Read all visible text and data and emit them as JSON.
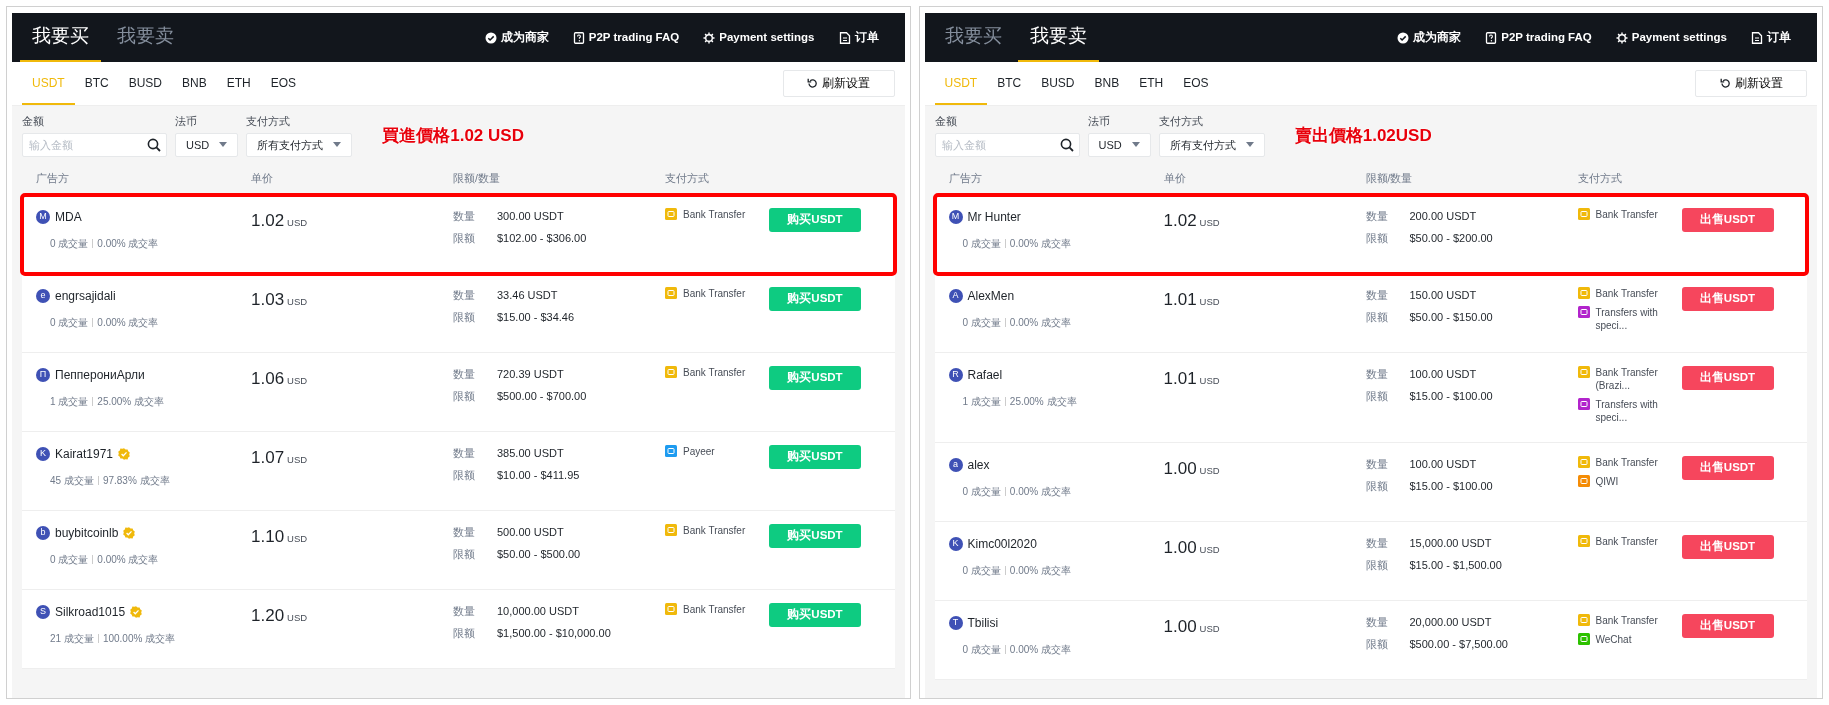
{
  "panels": [
    {
      "kind": "buy",
      "main_tabs": [
        {
          "label": "我要买",
          "selected": true
        },
        {
          "label": "我要卖",
          "selected": false
        }
      ],
      "header_links": [
        "成为商家",
        "P2P trading FAQ",
        "Payment settings",
        "订单"
      ],
      "asset_tabs": [
        {
          "label": "USDT",
          "selected": true
        },
        {
          "label": "BTC",
          "selected": false
        },
        {
          "label": "BUSD",
          "selected": false
        },
        {
          "label": "BNB",
          "selected": false
        },
        {
          "label": "ETH",
          "selected": false
        },
        {
          "label": "EOS",
          "selected": false
        }
      ],
      "refresh_button": "刷新设置",
      "filters": {
        "amount_label": "金额",
        "amount_placeholder": "输入金额",
        "fiat_label": "法币",
        "fiat_value": "USD",
        "payment_label": "支付方式",
        "payment_value": "所有支付方式"
      },
      "annotation": "買進價格1.02 USD",
      "columns": [
        "广告方",
        "单价",
        "限额/数量",
        "支付方式"
      ],
      "rows": [
        {
          "avatar": "M",
          "name": "MDA",
          "verified": false,
          "trades": "0 成交量",
          "rate": "0.00% 成交率",
          "price": "1.02",
          "currency": "USD",
          "quantity_label": "数量",
          "quantity": "300.00 USDT",
          "limit_label": "限额",
          "limit": "$102.00 - $306.00",
          "payments": [
            {
              "label": "Bank Transfer",
              "color": "#f0b90b"
            }
          ],
          "action": "购买USDT",
          "highlighted": true
        },
        {
          "avatar": "e",
          "name": "engrsajidali",
          "verified": false,
          "trades": "0 成交量",
          "rate": "0.00% 成交率",
          "price": "1.03",
          "currency": "USD",
          "quantity_label": "数量",
          "quantity": "33.46 USDT",
          "limit_label": "限额",
          "limit": "$15.00 - $34.46",
          "payments": [
            {
              "label": "Bank Transfer",
              "color": "#f0b90b"
            }
          ],
          "action": "购买USDT",
          "highlighted": false
        },
        {
          "avatar": "П",
          "name": "ПепперониАрли",
          "verified": false,
          "trades": "1 成交量",
          "rate": "25.00% 成交率",
          "price": "1.06",
          "currency": "USD",
          "quantity_label": "数量",
          "quantity": "720.39 USDT",
          "limit_label": "限额",
          "limit": "$500.00 - $700.00",
          "payments": [
            {
              "label": "Bank Transfer",
              "color": "#f0b90b"
            }
          ],
          "action": "购买USDT",
          "highlighted": false
        },
        {
          "avatar": "K",
          "name": "Kairat1971",
          "verified": true,
          "trades": "45 成交量",
          "rate": "97.83% 成交率",
          "price": "1.07",
          "currency": "USD",
          "quantity_label": "数量",
          "quantity": "385.00 USDT",
          "limit_label": "限额",
          "limit": "$10.00 - $411.95",
          "payments": [
            {
              "label": "Payeer",
              "color": "#1d9bf0"
            }
          ],
          "action": "购买USDT",
          "highlighted": false
        },
        {
          "avatar": "b",
          "name": "buybitcoinlb",
          "verified": true,
          "trades": "0 成交量",
          "rate": "0.00% 成交率",
          "price": "1.10",
          "currency": "USD",
          "quantity_label": "数量",
          "quantity": "500.00 USDT",
          "limit_label": "限额",
          "limit": "$50.00 - $500.00",
          "payments": [
            {
              "label": "Bank Transfer",
              "color": "#f0b90b"
            }
          ],
          "action": "购买USDT",
          "highlighted": false
        },
        {
          "avatar": "S",
          "name": "Silkroad1015",
          "verified": true,
          "trades": "21 成交量",
          "rate": "100.00% 成交率",
          "price": "1.20",
          "currency": "USD",
          "quantity_label": "数量",
          "quantity": "10,000.00 USDT",
          "limit_label": "限额",
          "limit": "$1,500.00 - $10,000.00",
          "payments": [
            {
              "label": "Bank Transfer",
              "color": "#f0b90b"
            }
          ],
          "action": "购买USDT",
          "highlighted": false
        }
      ]
    },
    {
      "kind": "sell",
      "main_tabs": [
        {
          "label": "我要买",
          "selected": false
        },
        {
          "label": "我要卖",
          "selected": true
        }
      ],
      "header_links": [
        "成为商家",
        "P2P trading FAQ",
        "Payment settings",
        "订单"
      ],
      "asset_tabs": [
        {
          "label": "USDT",
          "selected": true
        },
        {
          "label": "BTC",
          "selected": false
        },
        {
          "label": "BUSD",
          "selected": false
        },
        {
          "label": "BNB",
          "selected": false
        },
        {
          "label": "ETH",
          "selected": false
        },
        {
          "label": "EOS",
          "selected": false
        }
      ],
      "refresh_button": "刷新设置",
      "filters": {
        "amount_label": "金额",
        "amount_placeholder": "输入金额",
        "fiat_label": "法币",
        "fiat_value": "USD",
        "payment_label": "支付方式",
        "payment_value": "所有支付方式"
      },
      "annotation": "賣出價格1.02USD",
      "columns": [
        "广告方",
        "单价",
        "限额/数量",
        "支付方式"
      ],
      "rows": [
        {
          "avatar": "M",
          "name": "Mr Hunter",
          "verified": false,
          "trades": "0 成交量",
          "rate": "0.00% 成交率",
          "price": "1.02",
          "currency": "USD",
          "quantity_label": "数量",
          "quantity": "200.00 USDT",
          "limit_label": "限额",
          "limit": "$50.00 - $200.00",
          "payments": [
            {
              "label": "Bank Transfer",
              "color": "#f0b90b"
            }
          ],
          "action": "出售USDT",
          "highlighted": true
        },
        {
          "avatar": "A",
          "name": "AlexMen",
          "verified": false,
          "trades": "0 成交量",
          "rate": "0.00% 成交率",
          "price": "1.01",
          "currency": "USD",
          "quantity_label": "数量",
          "quantity": "150.00 USDT",
          "limit_label": "限额",
          "limit": "$50.00 - $150.00",
          "payments": [
            {
              "label": "Bank Transfer",
              "color": "#f0b90b"
            },
            {
              "label": "Transfers with speci...",
              "color": "#b224cc"
            }
          ],
          "action": "出售USDT",
          "highlighted": false
        },
        {
          "avatar": "R",
          "name": "Rafael",
          "verified": false,
          "trades": "1 成交量",
          "rate": "25.00% 成交率",
          "price": "1.01",
          "currency": "USD",
          "quantity_label": "数量",
          "quantity": "100.00 USDT",
          "limit_label": "限额",
          "limit": "$15.00 - $100.00",
          "payments": [
            {
              "label": "Bank Transfer (Brazi...",
              "color": "#f0b90b"
            },
            {
              "label": "Transfers with speci...",
              "color": "#b224cc"
            }
          ],
          "action": "出售USDT",
          "highlighted": false
        },
        {
          "avatar": "a",
          "name": "alex",
          "verified": false,
          "trades": "0 成交量",
          "rate": "0.00% 成交率",
          "price": "1.00",
          "currency": "USD",
          "quantity_label": "数量",
          "quantity": "100.00 USDT",
          "limit_label": "限额",
          "limit": "$15.00 - $100.00",
          "payments": [
            {
              "label": "Bank Transfer",
              "color": "#f0b90b"
            },
            {
              "label": "QIWI",
              "color": "#f48c06"
            }
          ],
          "action": "出售USDT",
          "highlighted": false
        },
        {
          "avatar": "K",
          "name": "Kimc00l2020",
          "verified": false,
          "trades": "0 成交量",
          "rate": "0.00% 成交率",
          "price": "1.00",
          "currency": "USD",
          "quantity_label": "数量",
          "quantity": "15,000.00 USDT",
          "limit_label": "限额",
          "limit": "$15.00 - $1,500.00",
          "payments": [
            {
              "label": "Bank Transfer",
              "color": "#f0b90b"
            }
          ],
          "action": "出售USDT",
          "highlighted": false
        },
        {
          "avatar": "T",
          "name": "Tbilisi",
          "verified": false,
          "trades": "0 成交量",
          "rate": "0.00% 成交率",
          "price": "1.00",
          "currency": "USD",
          "quantity_label": "数量",
          "quantity": "20,000.00 USDT",
          "limit_label": "限额",
          "limit": "$500.00 - $7,500.00",
          "payments": [
            {
              "label": "Bank Transfer",
              "color": "#f0b90b"
            },
            {
              "label": "WeChat",
              "color": "#2dc100"
            }
          ],
          "action": "出售USDT",
          "highlighted": false
        }
      ]
    }
  ]
}
